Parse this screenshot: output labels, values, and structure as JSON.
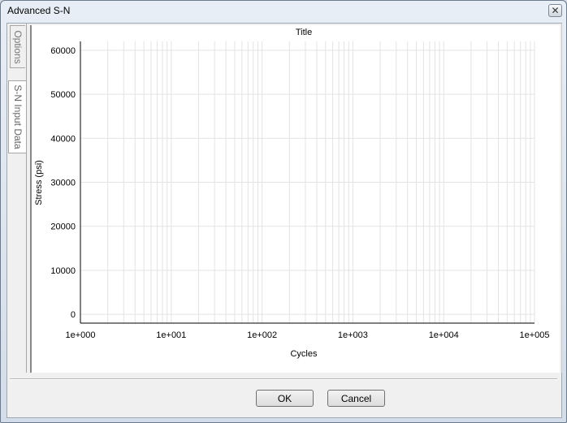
{
  "window": {
    "title": "Advanced S-N",
    "close_glyph": "✕"
  },
  "tabs": [
    {
      "label": "Options",
      "active": false
    },
    {
      "label": "S-N Input Data",
      "active": true
    }
  ],
  "chart_data": {
    "type": "scatter",
    "title": "Title",
    "xlabel": "Cycles",
    "ylabel": "Stress (psi)",
    "x_scale": "log",
    "xlim": [
      1,
      100000
    ],
    "ylim": [
      -2000,
      62000
    ],
    "x_tick_labels": [
      "1e+000",
      "1e+001",
      "1e+002",
      "1e+003",
      "1e+004",
      "1e+005"
    ],
    "y_tick_labels": [
      "0",
      "10000",
      "20000",
      "30000",
      "40000",
      "50000",
      "60000"
    ],
    "y_ticks": [
      0,
      10000,
      20000,
      30000,
      40000,
      50000,
      60000
    ],
    "grid": true,
    "series": []
  },
  "buttons": {
    "ok": "OK",
    "cancel": "Cancel"
  }
}
